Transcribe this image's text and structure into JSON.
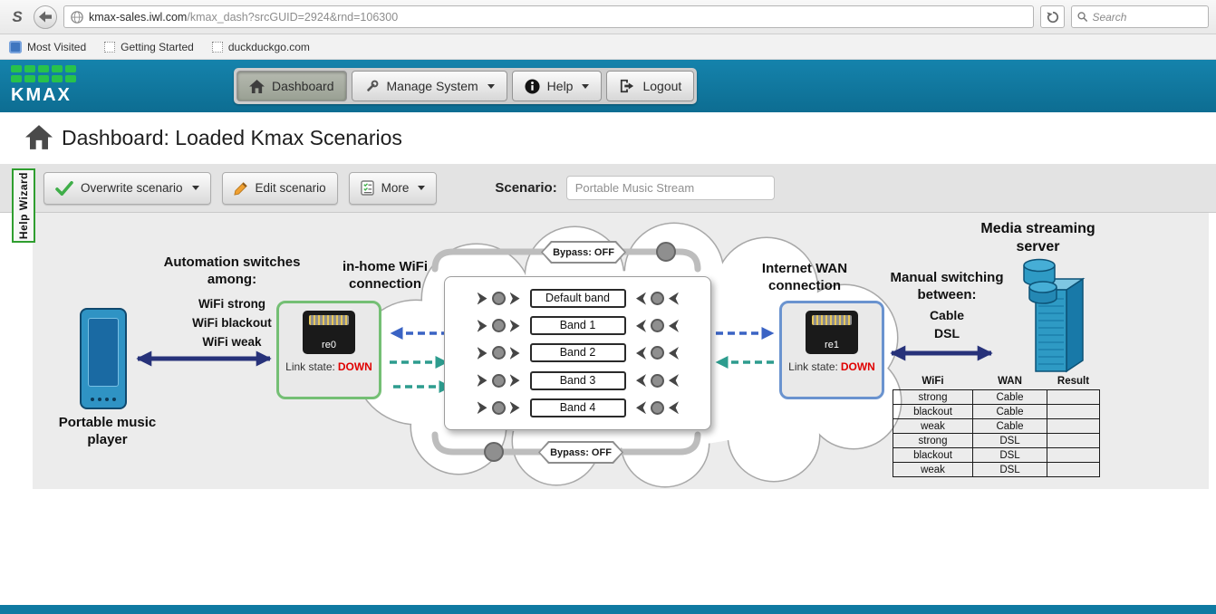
{
  "browser": {
    "logo_glyph": "S",
    "url_domain": "kmax-sales.iwl.com",
    "url_path": "/kmax_dash?srcGUID=2924&rnd=106300",
    "search_placeholder": "Search",
    "bookmarks": [
      "Most Visited",
      "Getting Started",
      "duckduckgo.com"
    ]
  },
  "header": {
    "logo_text": "KMAX",
    "nav": [
      {
        "label": "Dashboard"
      },
      {
        "label": "Manage System"
      },
      {
        "label": "Help"
      },
      {
        "label": "Logout"
      }
    ]
  },
  "title_bar": {
    "title": "Dashboard: Loaded Kmax Scenarios",
    "ports": [
      "re0",
      "re1"
    ]
  },
  "toolbar": {
    "help_wizard": "Help Wizard",
    "overwrite_label": "Overwrite scenario",
    "edit_label": "Edit scenario",
    "more_label": "More",
    "scenario_label": "Scenario:",
    "scenario_value": "Portable Music Stream"
  },
  "diagram": {
    "automation_title": "Automation switches among:",
    "automation_items": [
      "WiFi strong",
      "WiFi blackout",
      "WiFi weak"
    ],
    "player_label": "Portable music player",
    "wifi_label": "in-home WiFi connection",
    "wan_label": "Internet WAN connection",
    "server_label": "Media streaming server",
    "manual_title": "Manual switching between:",
    "manual_items": [
      "Cable",
      "DSL"
    ],
    "bypass_top": "Bypass: OFF",
    "bypass_bottom": "Bypass: OFF",
    "re0": {
      "name": "re0",
      "link_label": "Link state:",
      "link_state": "DOWN"
    },
    "re1": {
      "name": "re1",
      "link_label": "Link state:",
      "link_state": "DOWN"
    },
    "bands": [
      "Default band",
      "Band 1",
      "Band 2",
      "Band 3",
      "Band 4"
    ],
    "table": {
      "headers": [
        "WiFi",
        "WAN",
        "Result"
      ],
      "rows": [
        [
          "strong",
          "Cable",
          ""
        ],
        [
          "blackout",
          "Cable",
          ""
        ],
        [
          "weak",
          "Cable",
          ""
        ],
        [
          "strong",
          "DSL",
          ""
        ],
        [
          "blackout",
          "DSL",
          ""
        ],
        [
          "weak",
          "DSL",
          ""
        ]
      ]
    }
  },
  "colors": {
    "header_teal": "#0f78a0",
    "port_green": "#74bf74",
    "port_blue": "#6a93cf",
    "link_down_red": "#e00000",
    "navy_arrow": "#27327a",
    "teal_arrow": "#2d9c8e",
    "blue_arrow": "#3a63c4"
  }
}
